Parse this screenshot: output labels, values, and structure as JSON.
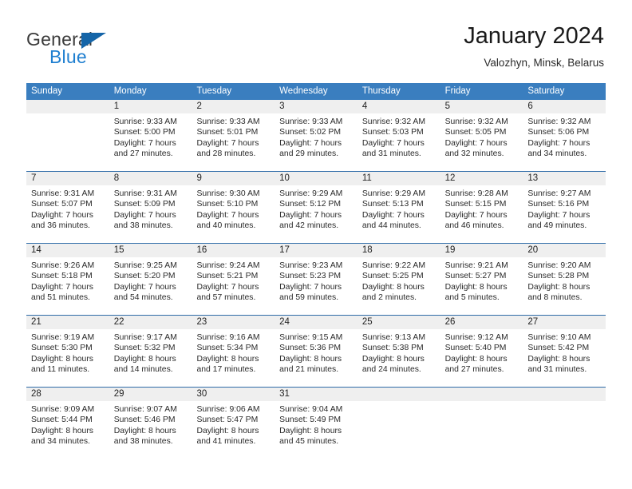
{
  "brand": {
    "name_top": "General",
    "name_bottom": "Blue",
    "accent_color": "#1f7fd0",
    "triangle_color": "#1565a8"
  },
  "header": {
    "title": "January 2024",
    "subtitle": "Valozhyn, Minsk, Belarus"
  },
  "calendar": {
    "header_bg": "#3a7ebf",
    "day_band_bg": "#efefef",
    "weekdays": [
      "Sunday",
      "Monday",
      "Tuesday",
      "Wednesday",
      "Thursday",
      "Friday",
      "Saturday"
    ],
    "weeks": [
      [
        {
          "day": ""
        },
        {
          "day": "1",
          "sunrise": "Sunrise: 9:33 AM",
          "sunset": "Sunset: 5:00 PM",
          "daylight1": "Daylight: 7 hours",
          "daylight2": "and 27 minutes."
        },
        {
          "day": "2",
          "sunrise": "Sunrise: 9:33 AM",
          "sunset": "Sunset: 5:01 PM",
          "daylight1": "Daylight: 7 hours",
          "daylight2": "and 28 minutes."
        },
        {
          "day": "3",
          "sunrise": "Sunrise: 9:33 AM",
          "sunset": "Sunset: 5:02 PM",
          "daylight1": "Daylight: 7 hours",
          "daylight2": "and 29 minutes."
        },
        {
          "day": "4",
          "sunrise": "Sunrise: 9:32 AM",
          "sunset": "Sunset: 5:03 PM",
          "daylight1": "Daylight: 7 hours",
          "daylight2": "and 31 minutes."
        },
        {
          "day": "5",
          "sunrise": "Sunrise: 9:32 AM",
          "sunset": "Sunset: 5:05 PM",
          "daylight1": "Daylight: 7 hours",
          "daylight2": "and 32 minutes."
        },
        {
          "day": "6",
          "sunrise": "Sunrise: 9:32 AM",
          "sunset": "Sunset: 5:06 PM",
          "daylight1": "Daylight: 7 hours",
          "daylight2": "and 34 minutes."
        }
      ],
      [
        {
          "day": "7",
          "sunrise": "Sunrise: 9:31 AM",
          "sunset": "Sunset: 5:07 PM",
          "daylight1": "Daylight: 7 hours",
          "daylight2": "and 36 minutes."
        },
        {
          "day": "8",
          "sunrise": "Sunrise: 9:31 AM",
          "sunset": "Sunset: 5:09 PM",
          "daylight1": "Daylight: 7 hours",
          "daylight2": "and 38 minutes."
        },
        {
          "day": "9",
          "sunrise": "Sunrise: 9:30 AM",
          "sunset": "Sunset: 5:10 PM",
          "daylight1": "Daylight: 7 hours",
          "daylight2": "and 40 minutes."
        },
        {
          "day": "10",
          "sunrise": "Sunrise: 9:29 AM",
          "sunset": "Sunset: 5:12 PM",
          "daylight1": "Daylight: 7 hours",
          "daylight2": "and 42 minutes."
        },
        {
          "day": "11",
          "sunrise": "Sunrise: 9:29 AM",
          "sunset": "Sunset: 5:13 PM",
          "daylight1": "Daylight: 7 hours",
          "daylight2": "and 44 minutes."
        },
        {
          "day": "12",
          "sunrise": "Sunrise: 9:28 AM",
          "sunset": "Sunset: 5:15 PM",
          "daylight1": "Daylight: 7 hours",
          "daylight2": "and 46 minutes."
        },
        {
          "day": "13",
          "sunrise": "Sunrise: 9:27 AM",
          "sunset": "Sunset: 5:16 PM",
          "daylight1": "Daylight: 7 hours",
          "daylight2": "and 49 minutes."
        }
      ],
      [
        {
          "day": "14",
          "sunrise": "Sunrise: 9:26 AM",
          "sunset": "Sunset: 5:18 PM",
          "daylight1": "Daylight: 7 hours",
          "daylight2": "and 51 minutes."
        },
        {
          "day": "15",
          "sunrise": "Sunrise: 9:25 AM",
          "sunset": "Sunset: 5:20 PM",
          "daylight1": "Daylight: 7 hours",
          "daylight2": "and 54 minutes."
        },
        {
          "day": "16",
          "sunrise": "Sunrise: 9:24 AM",
          "sunset": "Sunset: 5:21 PM",
          "daylight1": "Daylight: 7 hours",
          "daylight2": "and 57 minutes."
        },
        {
          "day": "17",
          "sunrise": "Sunrise: 9:23 AM",
          "sunset": "Sunset: 5:23 PM",
          "daylight1": "Daylight: 7 hours",
          "daylight2": "and 59 minutes."
        },
        {
          "day": "18",
          "sunrise": "Sunrise: 9:22 AM",
          "sunset": "Sunset: 5:25 PM",
          "daylight1": "Daylight: 8 hours",
          "daylight2": "and 2 minutes."
        },
        {
          "day": "19",
          "sunrise": "Sunrise: 9:21 AM",
          "sunset": "Sunset: 5:27 PM",
          "daylight1": "Daylight: 8 hours",
          "daylight2": "and 5 minutes."
        },
        {
          "day": "20",
          "sunrise": "Sunrise: 9:20 AM",
          "sunset": "Sunset: 5:28 PM",
          "daylight1": "Daylight: 8 hours",
          "daylight2": "and 8 minutes."
        }
      ],
      [
        {
          "day": "21",
          "sunrise": "Sunrise: 9:19 AM",
          "sunset": "Sunset: 5:30 PM",
          "daylight1": "Daylight: 8 hours",
          "daylight2": "and 11 minutes."
        },
        {
          "day": "22",
          "sunrise": "Sunrise: 9:17 AM",
          "sunset": "Sunset: 5:32 PM",
          "daylight1": "Daylight: 8 hours",
          "daylight2": "and 14 minutes."
        },
        {
          "day": "23",
          "sunrise": "Sunrise: 9:16 AM",
          "sunset": "Sunset: 5:34 PM",
          "daylight1": "Daylight: 8 hours",
          "daylight2": "and 17 minutes."
        },
        {
          "day": "24",
          "sunrise": "Sunrise: 9:15 AM",
          "sunset": "Sunset: 5:36 PM",
          "daylight1": "Daylight: 8 hours",
          "daylight2": "and 21 minutes."
        },
        {
          "day": "25",
          "sunrise": "Sunrise: 9:13 AM",
          "sunset": "Sunset: 5:38 PM",
          "daylight1": "Daylight: 8 hours",
          "daylight2": "and 24 minutes."
        },
        {
          "day": "26",
          "sunrise": "Sunrise: 9:12 AM",
          "sunset": "Sunset: 5:40 PM",
          "daylight1": "Daylight: 8 hours",
          "daylight2": "and 27 minutes."
        },
        {
          "day": "27",
          "sunrise": "Sunrise: 9:10 AM",
          "sunset": "Sunset: 5:42 PM",
          "daylight1": "Daylight: 8 hours",
          "daylight2": "and 31 minutes."
        }
      ],
      [
        {
          "day": "28",
          "sunrise": "Sunrise: 9:09 AM",
          "sunset": "Sunset: 5:44 PM",
          "daylight1": "Daylight: 8 hours",
          "daylight2": "and 34 minutes."
        },
        {
          "day": "29",
          "sunrise": "Sunrise: 9:07 AM",
          "sunset": "Sunset: 5:46 PM",
          "daylight1": "Daylight: 8 hours",
          "daylight2": "and 38 minutes."
        },
        {
          "day": "30",
          "sunrise": "Sunrise: 9:06 AM",
          "sunset": "Sunset: 5:47 PM",
          "daylight1": "Daylight: 8 hours",
          "daylight2": "and 41 minutes."
        },
        {
          "day": "31",
          "sunrise": "Sunrise: 9:04 AM",
          "sunset": "Sunset: 5:49 PM",
          "daylight1": "Daylight: 8 hours",
          "daylight2": "and 45 minutes."
        },
        {
          "day": ""
        },
        {
          "day": ""
        },
        {
          "day": ""
        }
      ]
    ]
  }
}
